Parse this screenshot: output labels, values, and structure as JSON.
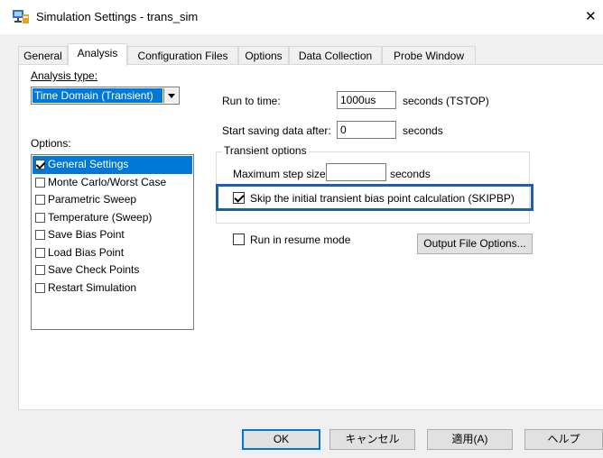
{
  "window": {
    "title": "Simulation Settings - trans_sim",
    "close_glyph": "✕"
  },
  "tabs": [
    {
      "label": "General"
    },
    {
      "label": "Analysis"
    },
    {
      "label": "Configuration Files"
    },
    {
      "label": "Options"
    },
    {
      "label": "Data Collection"
    },
    {
      "label": "Probe Window"
    }
  ],
  "analysis": {
    "analysis_type_label": "Analysis type:",
    "analysis_type_value": "Time Domain (Transient)",
    "options_label": "Options:",
    "options": [
      {
        "label": "General Settings",
        "checked": true,
        "selected": true
      },
      {
        "label": "Monte Carlo/Worst Case",
        "checked": false
      },
      {
        "label": "Parametric Sweep",
        "checked": false
      },
      {
        "label": "Temperature (Sweep)",
        "checked": false
      },
      {
        "label": "Save Bias Point",
        "checked": false
      },
      {
        "label": "Load Bias Point",
        "checked": false
      },
      {
        "label": "Save Check Points",
        "checked": false
      },
      {
        "label": "Restart Simulation",
        "checked": false
      }
    ],
    "run_to_time_label": "Run to time:",
    "run_to_time_value": "1000us",
    "run_to_time_unit": "seconds (TSTOP)",
    "start_saving_label": "Start saving data after:",
    "start_saving_value": "0",
    "start_saving_unit": "seconds",
    "transient_options_label": "Transient options",
    "max_step_label": "Maximum step size:",
    "max_step_value": "",
    "max_step_unit": "seconds",
    "skip_bias_label": "Skip the initial transient bias point calculation (SKIPBP)",
    "skip_bias_checked": true,
    "resume_label": "Run in resume mode",
    "resume_checked": false,
    "output_file_options": "Output File Options..."
  },
  "footer": {
    "ok": "OK",
    "cancel": "キャンセル",
    "apply": "適用(A)",
    "help": "ヘルプ"
  },
  "colors": {
    "accent": "#0078d7",
    "highlight_box": "#1f5fa8"
  }
}
